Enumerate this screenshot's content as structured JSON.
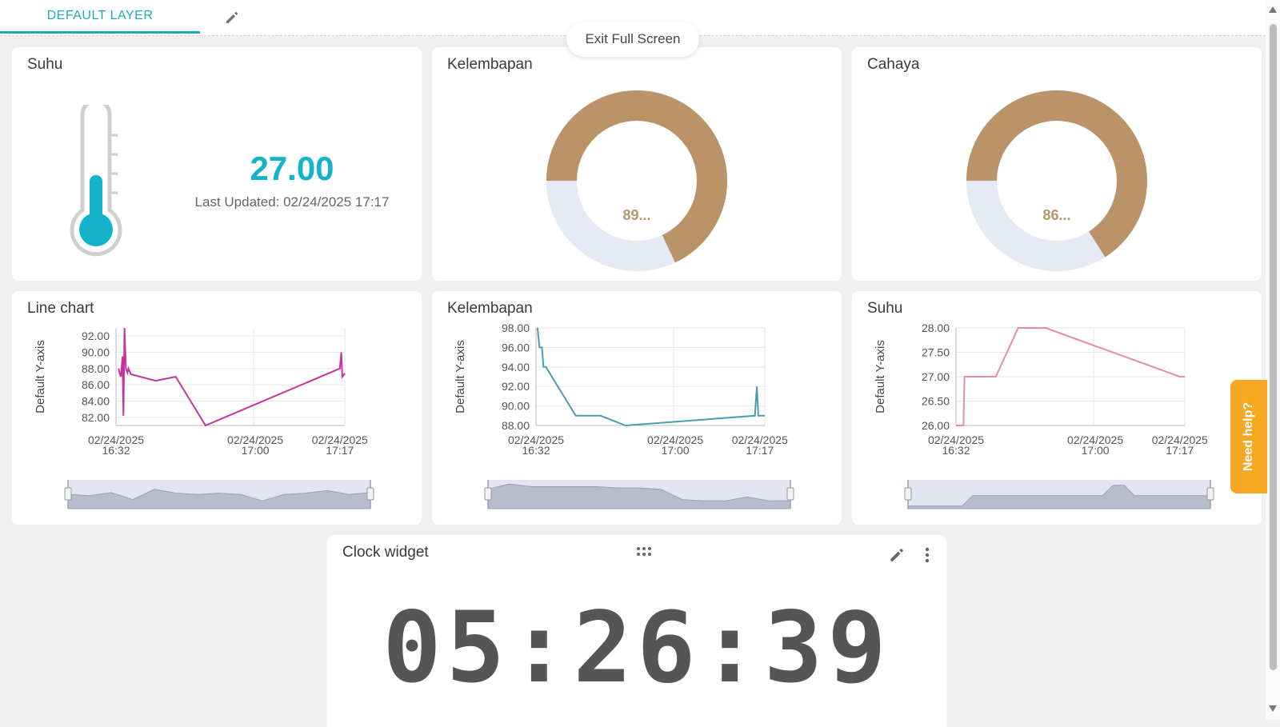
{
  "layer_tab": {
    "label": "DEFAULT LAYER"
  },
  "exit_fullscreen_label": "Exit Full Screen",
  "widgets": {
    "suhu_value": {
      "title": "Suhu",
      "value": "27.00",
      "last_updated": "Last Updated: 02/24/2025 17:17",
      "thermometer_fill_fraction": 0.45,
      "accent": "#12b3cb"
    },
    "kelembapan_gauge": {
      "title": "Kelembapan",
      "label": "89...",
      "fill_fraction": 0.68,
      "fill_color": "#ba9468",
      "track_color": "#e6eaf5"
    },
    "cahaya_gauge": {
      "title": "Cahaya",
      "label": "86...",
      "fill_fraction": 0.66,
      "fill_color": "#ba9468",
      "track_color": "#e6eaf5"
    },
    "line_chart_1": {
      "title": "Line chart"
    },
    "line_chart_2": {
      "title": "Kelembapan"
    },
    "line_chart_3": {
      "title": "Suhu"
    },
    "clock": {
      "title": "Clock widget",
      "time": "05:26:39"
    }
  },
  "need_help_label": "Need help?",
  "chart_data": [
    {
      "type": "line",
      "title": "Line chart",
      "ylabel": "Default Y-axis",
      "xlabel": "",
      "color": "#c8329e",
      "ylim": [
        81.0,
        93.0
      ],
      "yticks": [
        "92.00",
        "90.00",
        "88.00",
        "86.00",
        "84.00",
        "82.00"
      ],
      "ytick_values": [
        92,
        90,
        88,
        86,
        84,
        82
      ],
      "xticks": [
        {
          "label": [
            "02/24/2025",
            "16:32"
          ],
          "t": 0
        },
        {
          "label": [
            "02/24/2025",
            "17:00"
          ],
          "t": 28
        },
        {
          "label": [
            "02/24/2025",
            "17:17"
          ],
          "t": 45
        }
      ],
      "xlim": [
        0,
        46
      ],
      "points": [
        [
          0.5,
          88.0
        ],
        [
          0.8,
          87.3
        ],
        [
          1.0,
          87.0
        ],
        [
          1.3,
          89.5
        ],
        [
          1.5,
          82.2
        ],
        [
          1.7,
          93.0
        ],
        [
          2.0,
          88.0
        ],
        [
          2.3,
          87.5
        ],
        [
          2.5,
          88.0
        ],
        [
          3.0,
          87.3
        ],
        [
          8.0,
          86.5
        ],
        [
          12.0,
          87.0
        ],
        [
          18.0,
          81.0
        ],
        [
          45.0,
          88.0
        ],
        [
          45.3,
          90.0
        ],
        [
          45.5,
          87.0
        ],
        [
          46.0,
          87.4
        ]
      ],
      "navigator_points": [
        [
          0,
          0.55
        ],
        [
          4,
          0.5
        ],
        [
          8,
          0.62
        ],
        [
          12,
          0.35
        ],
        [
          16,
          0.75
        ],
        [
          20,
          0.6
        ],
        [
          24,
          0.55
        ],
        [
          28,
          0.6
        ],
        [
          32,
          0.55
        ],
        [
          36,
          0.3
        ],
        [
          40,
          0.55
        ],
        [
          44,
          0.6
        ],
        [
          48,
          0.7
        ],
        [
          52,
          0.55
        ],
        [
          56,
          0.62
        ]
      ]
    },
    {
      "type": "line",
      "title": "Kelembapan",
      "ylabel": "Default Y-axis",
      "xlabel": "",
      "color": "#4a9db0",
      "ylim": [
        88.0,
        98.0
      ],
      "yticks": [
        "98.00",
        "96.00",
        "94.00",
        "92.00",
        "90.00",
        "88.00"
      ],
      "ytick_values": [
        98,
        96,
        94,
        92,
        90,
        88
      ],
      "xticks": [
        {
          "label": [
            "02/24/2025",
            "16:32"
          ],
          "t": 0
        },
        {
          "label": [
            "02/24/2025",
            "17:00"
          ],
          "t": 28
        },
        {
          "label": [
            "02/24/2025",
            "17:17"
          ],
          "t": 45
        }
      ],
      "xlim": [
        0,
        46
      ],
      "points": [
        [
          0.3,
          98.0
        ],
        [
          0.5,
          97.0
        ],
        [
          0.7,
          96.0
        ],
        [
          1.2,
          96.0
        ],
        [
          1.5,
          94.0
        ],
        [
          2.0,
          94.0
        ],
        [
          8.0,
          89.0
        ],
        [
          13.0,
          89.0
        ],
        [
          18.0,
          88.0
        ],
        [
          44.0,
          89.0
        ],
        [
          44.4,
          92.0
        ],
        [
          44.7,
          89.0
        ],
        [
          46.0,
          89.0
        ]
      ],
      "navigator_points": [
        [
          0,
          0.75
        ],
        [
          4,
          0.95
        ],
        [
          8,
          0.85
        ],
        [
          12,
          0.85
        ],
        [
          16,
          0.85
        ],
        [
          20,
          0.85
        ],
        [
          24,
          0.8
        ],
        [
          28,
          0.8
        ],
        [
          32,
          0.75
        ],
        [
          36,
          0.35
        ],
        [
          40,
          0.3
        ],
        [
          44,
          0.3
        ],
        [
          48,
          0.45
        ],
        [
          52,
          0.3
        ],
        [
          56,
          0.3
        ]
      ]
    },
    {
      "type": "line",
      "title": "Suhu",
      "ylabel": "Default Y-axis",
      "xlabel": "",
      "color": "#e48bb3",
      "ylim": [
        26.0,
        28.0
      ],
      "yticks": [
        "28.00",
        "27.50",
        "27.00",
        "26.50",
        "26.00"
      ],
      "ytick_values": [
        28,
        27.5,
        27,
        26.5,
        26
      ],
      "xticks": [
        {
          "label": [
            "02/24/2025",
            "16:32"
          ],
          "t": 0
        },
        {
          "label": [
            "02/24/2025",
            "17:00"
          ],
          "t": 28
        },
        {
          "label": [
            "02/24/2025",
            "17:17"
          ],
          "t": 45
        }
      ],
      "xlim": [
        0,
        46
      ],
      "points": [
        [
          0,
          26.0
        ],
        [
          1.5,
          26.0
        ],
        [
          1.7,
          27.0
        ],
        [
          8.0,
          27.0
        ],
        [
          12.5,
          28.0
        ],
        [
          18.0,
          28.0
        ],
        [
          45.0,
          27.0
        ],
        [
          46.0,
          27.0
        ]
      ],
      "navigator_points": [
        [
          0,
          0.1
        ],
        [
          10,
          0.1
        ],
        [
          12,
          0.5
        ],
        [
          20,
          0.5
        ],
        [
          36,
          0.5
        ],
        [
          38,
          0.9
        ],
        [
          40,
          0.9
        ],
        [
          42,
          0.5
        ],
        [
          56,
          0.5
        ]
      ]
    }
  ]
}
